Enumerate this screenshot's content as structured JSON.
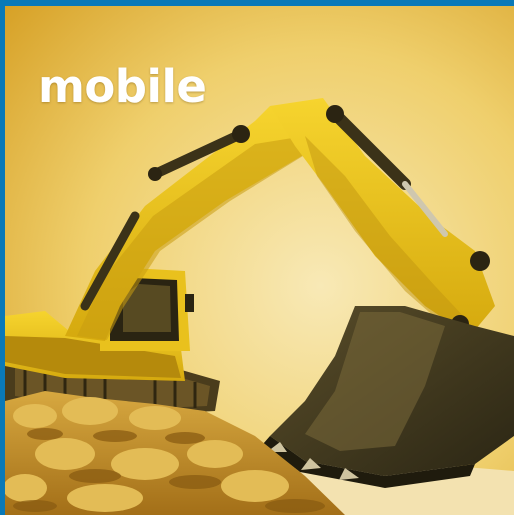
{
  "caption": "mobile",
  "image": {
    "subject": "excavator-photo",
    "colors": {
      "frame": "#0a79b8",
      "sky_light": "#f6e3a6",
      "sky_warm": "#e0ad2c",
      "machine_yellow": "#f1c61a",
      "machine_shadow": "#a77d08",
      "bucket_dark": "#3d3620",
      "ground": "#c8962e"
    }
  }
}
